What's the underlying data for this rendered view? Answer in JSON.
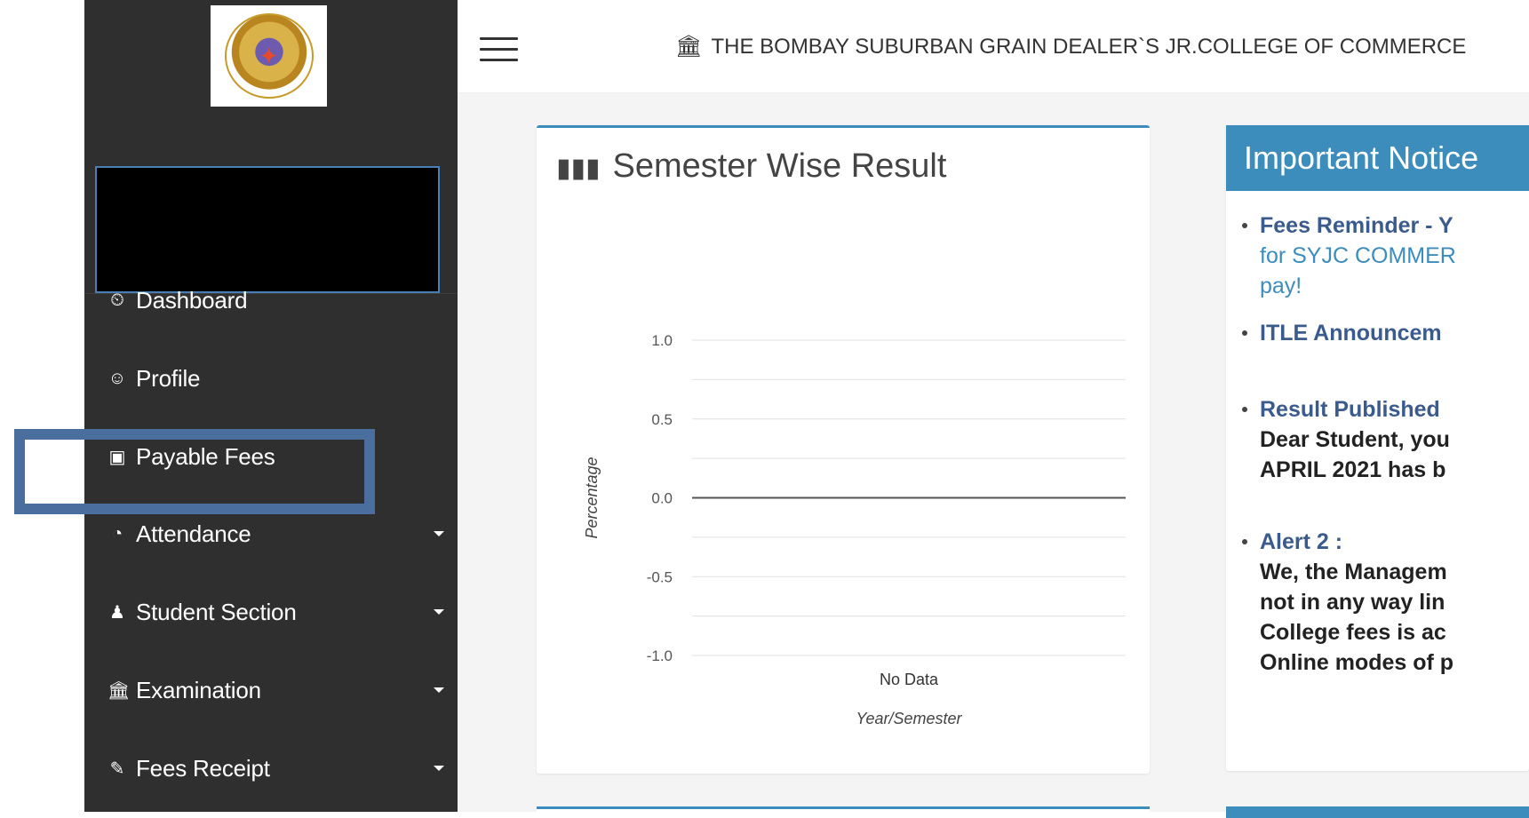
{
  "sidebar": {
    "items": [
      {
        "label": "Dashboard",
        "icon": "tachometer-icon",
        "glyph": "⏲",
        "has_caret": false
      },
      {
        "label": "Profile",
        "icon": "user-circle-icon",
        "glyph": "☺",
        "has_caret": false
      },
      {
        "label": "Payable Fees",
        "icon": "money-icon",
        "glyph": "▣",
        "has_caret": false
      },
      {
        "label": "Attendance",
        "icon": "clock-icon",
        "glyph": "◔",
        "has_caret": true
      },
      {
        "label": "Student Section",
        "icon": "user-icon",
        "glyph": "♟",
        "has_caret": true
      },
      {
        "label": "Examination",
        "icon": "institution-icon",
        "glyph": "🏛",
        "has_caret": true
      },
      {
        "label": "Fees Receipt",
        "icon": "ticket-icon",
        "glyph": "✎",
        "has_caret": true
      }
    ]
  },
  "header": {
    "title": "THE BOMBAY SUBURBAN GRAIN DEALER`S JR.COLLEGE OF COMMERCE",
    "title_icon": "institution-icon"
  },
  "result_card": {
    "title": "Semester Wise Result",
    "title_icon": "bar-chart-icon"
  },
  "chart_data": {
    "type": "line",
    "title": "",
    "xlabel": "Year/Semester",
    "ylabel": "Percentage",
    "categories": [
      "No Data"
    ],
    "series": [],
    "ylim": [
      -1.0,
      1.0
    ],
    "y_ticks": [
      "1.0",
      "0.5",
      "0.0",
      "-0.5",
      "-1.0"
    ],
    "y_tick_values": [
      1.0,
      0.5,
      0.0,
      -0.5,
      -1.0
    ],
    "grid": true,
    "colors": {
      "grid": "#e0e0e0",
      "zero_line": "#555555"
    }
  },
  "notice": {
    "title": "Important Notice",
    "items": [
      {
        "title": "Fees Reminder - Y",
        "text": "for SYJC COMMER",
        "text2": "pay!"
      },
      {
        "title": "ITLE Announcem"
      },
      {
        "title": "Result Published",
        "lines": [
          "Dear Student, you",
          "APRIL 2021 has b"
        ]
      },
      {
        "title": "Alert 2 :",
        "lines": [
          "We, the Managem",
          "not in any way lin",
          "College fees is ac",
          "Online modes of p"
        ]
      }
    ]
  },
  "colors": {
    "sidebar": "#2f2f2f",
    "accent": "#3c8dbc",
    "highlight": "#4a6f9e",
    "content_bg": "#f4f4f4"
  }
}
